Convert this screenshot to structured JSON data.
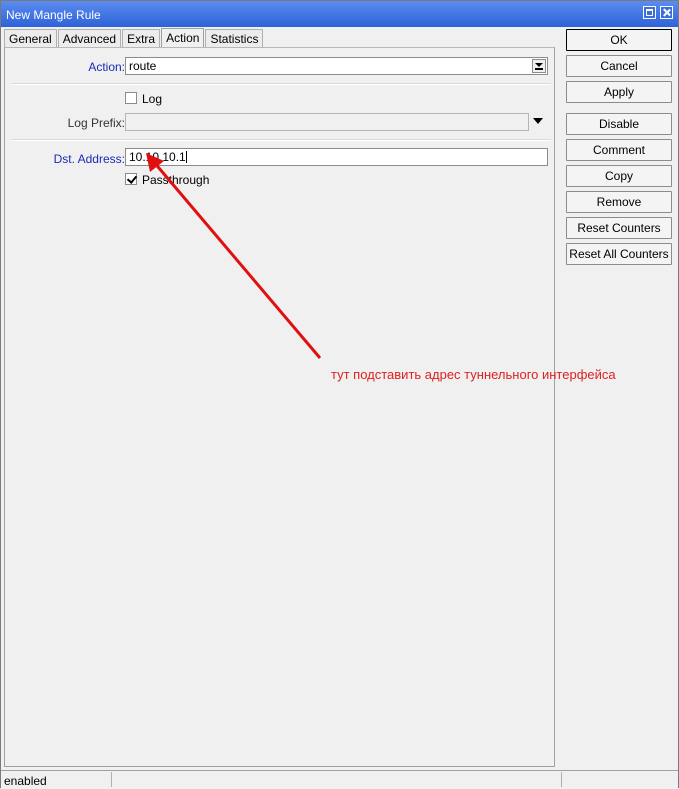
{
  "window": {
    "title": "New Mangle Rule"
  },
  "tabs": [
    "General",
    "Advanced",
    "Extra",
    "Action",
    "Statistics"
  ],
  "active_tab": "Action",
  "form": {
    "action": {
      "label": "Action:",
      "value": "route"
    },
    "log": {
      "label": "Log",
      "checked": false
    },
    "log_prefix": {
      "label": "Log Prefix:",
      "value": ""
    },
    "dst_address": {
      "label": "Dst. Address:",
      "value": "10.10.10.1"
    },
    "passthrough": {
      "label": "Passthrough",
      "checked": true
    }
  },
  "buttons": {
    "ok": "OK",
    "cancel": "Cancel",
    "apply": "Apply",
    "disable": "Disable",
    "comment": "Comment",
    "copy": "Copy",
    "remove": "Remove",
    "reset_counters": "Reset Counters",
    "reset_all_counters": "Reset All Counters"
  },
  "annotation": {
    "text": "тут подставить адрес туннельного интерфейса",
    "color": "#e02020"
  },
  "status": {
    "state": "enabled"
  },
  "colors": {
    "titlebar": "#3a6ee4",
    "label_blue": "#1a2bb5"
  }
}
